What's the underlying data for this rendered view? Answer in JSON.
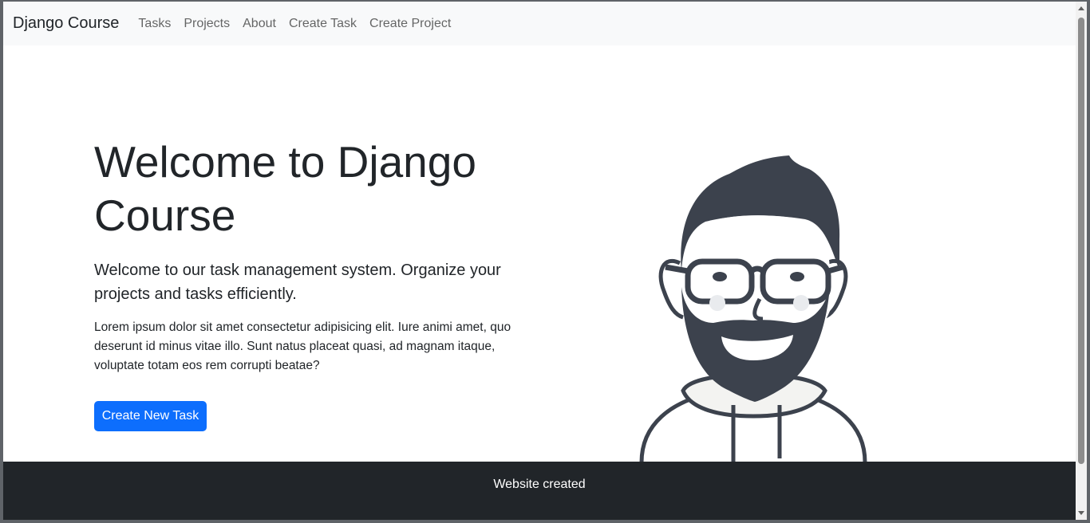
{
  "navbar": {
    "brand": "Django Course",
    "links": [
      "Tasks",
      "Projects",
      "About",
      "Create Task",
      "Create Project"
    ]
  },
  "hero": {
    "title": "Welcome to Django Course",
    "lead": "Welcome to our task management system. Organize your projects and tasks efficiently.",
    "body": "Lorem ipsum dolor sit amet consectetur adipisicing elit. Iure animi amet, quo deserunt id minus vitae illo. Sunt natus placeat quasi, ad magnam itaque, voluptate totam eos rem corrupti beatae?",
    "button_label": "Create New Task",
    "illustration": "bearded-man-with-glasses-illustration"
  },
  "footer": {
    "text": "Website created"
  },
  "colors": {
    "navbar_bg": "#f8f9fa",
    "primary": "#0d6efd",
    "footer_bg": "#212529",
    "illustration_dark": "#3c424d"
  }
}
